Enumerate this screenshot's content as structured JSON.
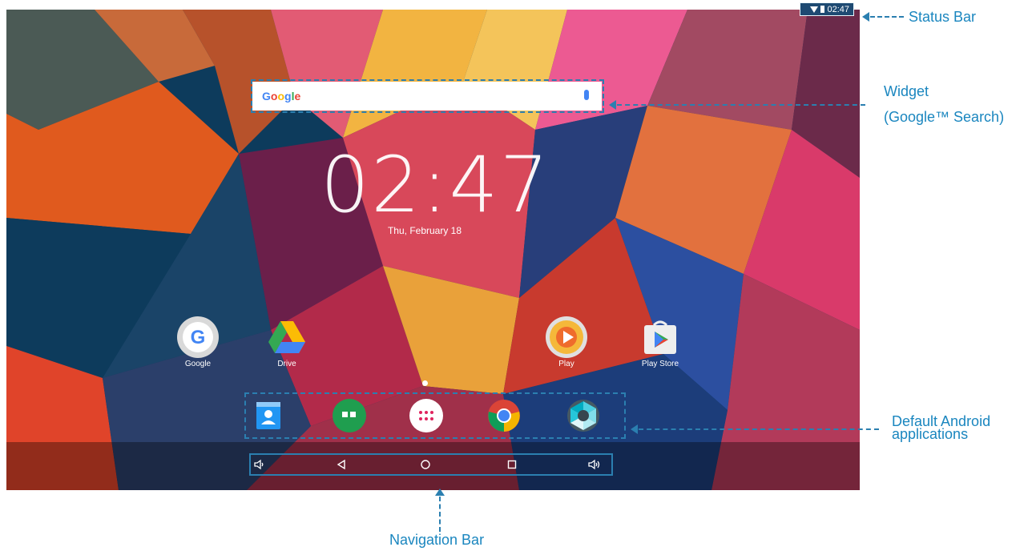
{
  "status_bar": {
    "time": "02:47",
    "wifi_icon": "wifi-icon",
    "battery_icon": "battery-icon"
  },
  "search_widget": {
    "logo_text": "Google",
    "mic_icon": "microphone-icon"
  },
  "clock": {
    "time": "02:47",
    "date": "Thu, February 18"
  },
  "desktop_apps": [
    {
      "label": "Google",
      "icon": "google-icon"
    },
    {
      "label": "Drive",
      "icon": "drive-icon"
    },
    {
      "label": "Play",
      "icon": "play-music-icon"
    },
    {
      "label": "Play Store",
      "icon": "play-store-icon"
    }
  ],
  "dock_apps": [
    {
      "icon": "contacts-icon"
    },
    {
      "icon": "hangouts-icon"
    },
    {
      "icon": "app-drawer-icon"
    },
    {
      "icon": "chrome-icon"
    },
    {
      "icon": "camera-icon"
    }
  ],
  "navigation_bar": {
    "buttons": [
      {
        "icon": "volume-down-icon",
        "glyph": "◁"
      },
      {
        "icon": "back-icon",
        "glyph": "◁"
      },
      {
        "icon": "home-icon",
        "glyph": "○"
      },
      {
        "icon": "recents-icon",
        "glyph": "□"
      },
      {
        "icon": "volume-up-icon",
        "glyph": "◁"
      }
    ]
  },
  "callouts": {
    "status_bar": "Status Bar",
    "widget_line1": "Widget",
    "widget_line2": "(Google™  Search)",
    "default_apps_line1": "Default Android",
    "default_apps_line2": "applications",
    "navigation_bar": "Navigation Bar"
  },
  "colors": {
    "accent": "#2b7fb0",
    "callout_text": "#1a86bf"
  }
}
